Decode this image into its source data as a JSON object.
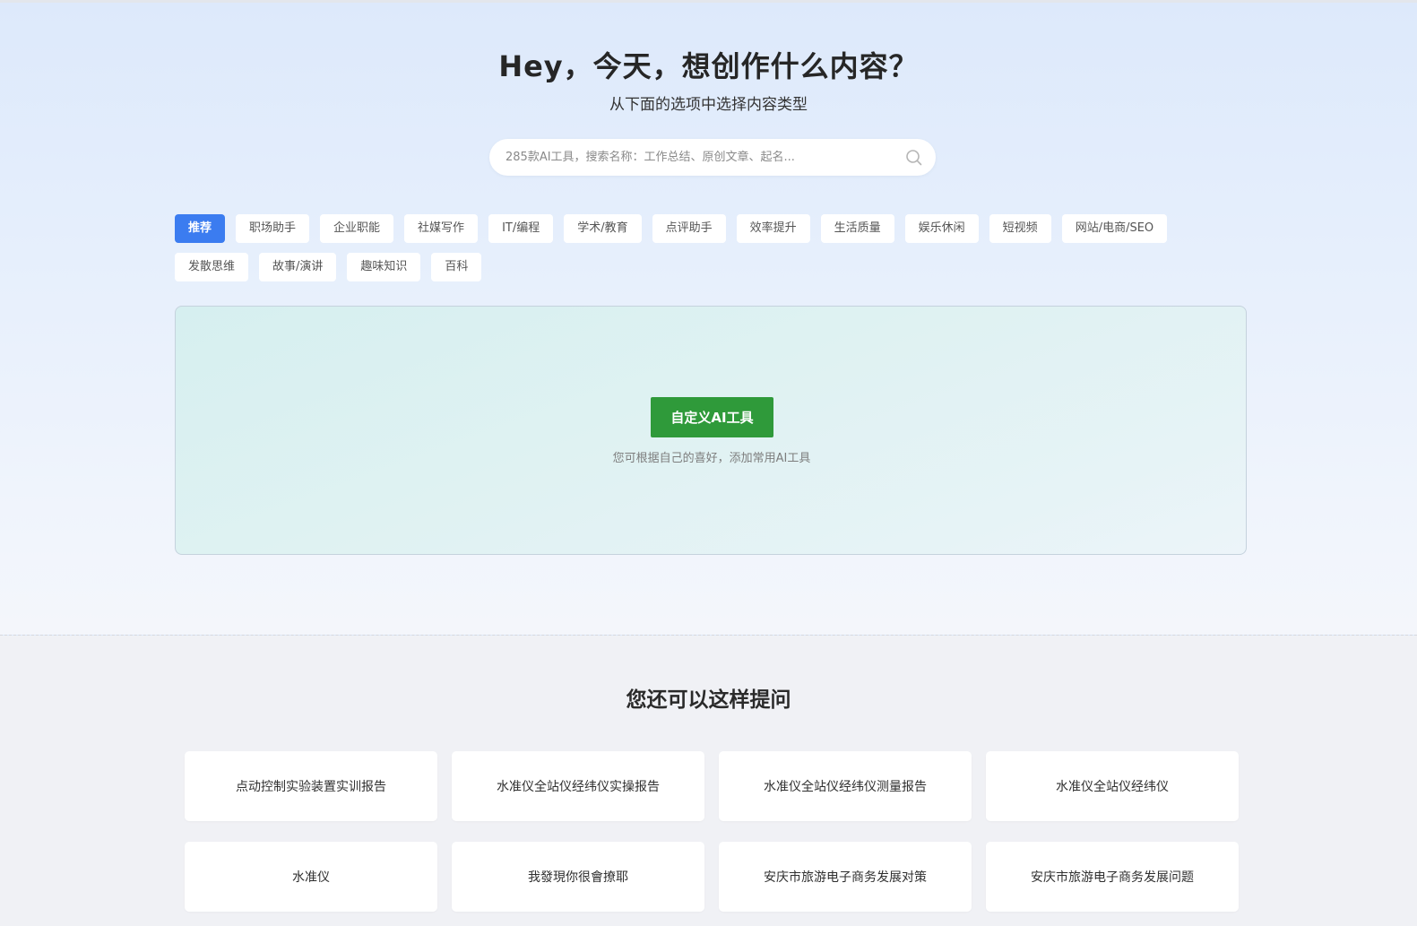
{
  "hero": {
    "title": "Hey，今天，想创作什么内容？",
    "subtitle": "从下面的选项中选择内容类型"
  },
  "search": {
    "placeholder": "285款AI工具，搜索名称：工作总结、原创文章、起名..."
  },
  "tags": {
    "row1": [
      {
        "label": "推荐",
        "active": true
      },
      {
        "label": "职场助手"
      },
      {
        "label": "企业职能"
      },
      {
        "label": "社媒写作"
      },
      {
        "label": "IT/编程"
      },
      {
        "label": "学术/教育"
      },
      {
        "label": "点评助手"
      },
      {
        "label": "效率提升"
      },
      {
        "label": "生活质量"
      },
      {
        "label": "娱乐休闲"
      },
      {
        "label": "短视频"
      },
      {
        "label": "网站/电商/SEO"
      }
    ],
    "row2": [
      {
        "label": "发散思维"
      },
      {
        "label": "故事/演讲"
      },
      {
        "label": "趣味知识"
      },
      {
        "label": "百科"
      }
    ]
  },
  "custom": {
    "button_label": "自定义AI工具",
    "hint": "您可根据自己的喜好，添加常用AI工具"
  },
  "suggestions": {
    "title": "您还可以这样提问",
    "items": [
      "点动控制实验装置实训报告",
      "水准仪全站仪经纬仪实操报告",
      "水准仪全站仪经纬仪测量报告",
      "水准仪全站仪经纬仪",
      "水准仪",
      "我發現你很會撩耶",
      "安庆市旅游电子商务发展对策",
      "安庆市旅游电子商务发展问题"
    ]
  },
  "colors": {
    "accent": "#3b7cf0",
    "button_green": "#2f9a3a"
  }
}
